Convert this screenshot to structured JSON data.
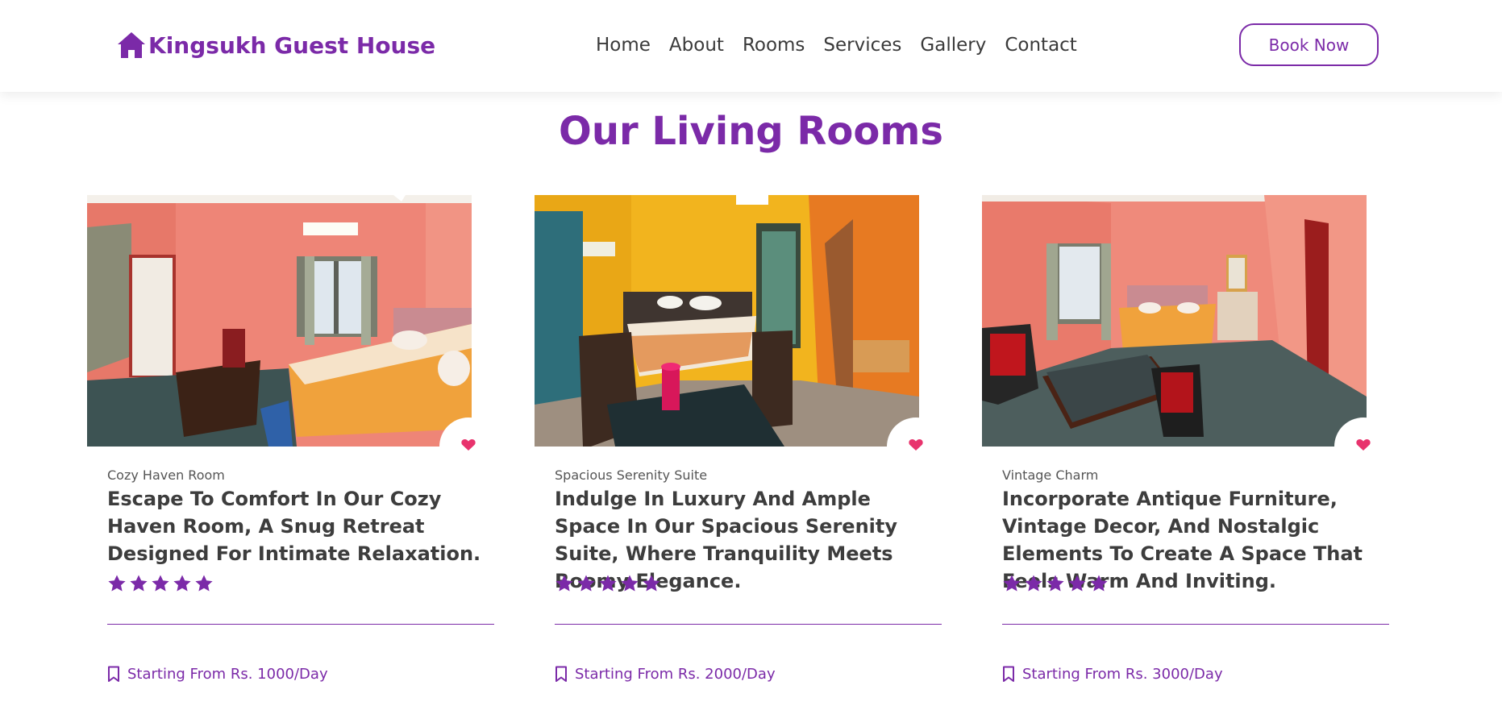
{
  "brand": {
    "name": "Kingsukh Guest House",
    "icon": "home-icon",
    "color": "#7b2aa8"
  },
  "nav": {
    "links": [
      "Home",
      "About",
      "Rooms",
      "Services",
      "Gallery",
      "Contact"
    ]
  },
  "book_button": {
    "label": "Book Now"
  },
  "section": {
    "title": "Our Living Rooms"
  },
  "rooms": [
    {
      "category": "Cozy Haven Room",
      "description": "Escape To Comfort In Our Cozy Haven Room, A Snug Retreat Designed For Intimate Relaxation.",
      "rating": 5,
      "price": "Starting From Rs. 1000/Day"
    },
    {
      "category": "Spacious Serenity Suite",
      "description": "Indulge In Luxury And Ample Space In Our Spacious Serenity Suite, Where Tranquility Meets Roomy Elegance.",
      "rating": 5,
      "price": "Starting From Rs. 2000/Day"
    },
    {
      "category": "Vintage Charm",
      "description": "Incorporate Antique Furniture, Vintage Decor, And Nostalgic Elements To Create A Space That Feels Warm And Inviting.",
      "rating": 5,
      "price": "Starting From Rs. 3000/Day"
    }
  ],
  "colors": {
    "accent": "#7b2aa8",
    "heart": "#e8336d"
  }
}
